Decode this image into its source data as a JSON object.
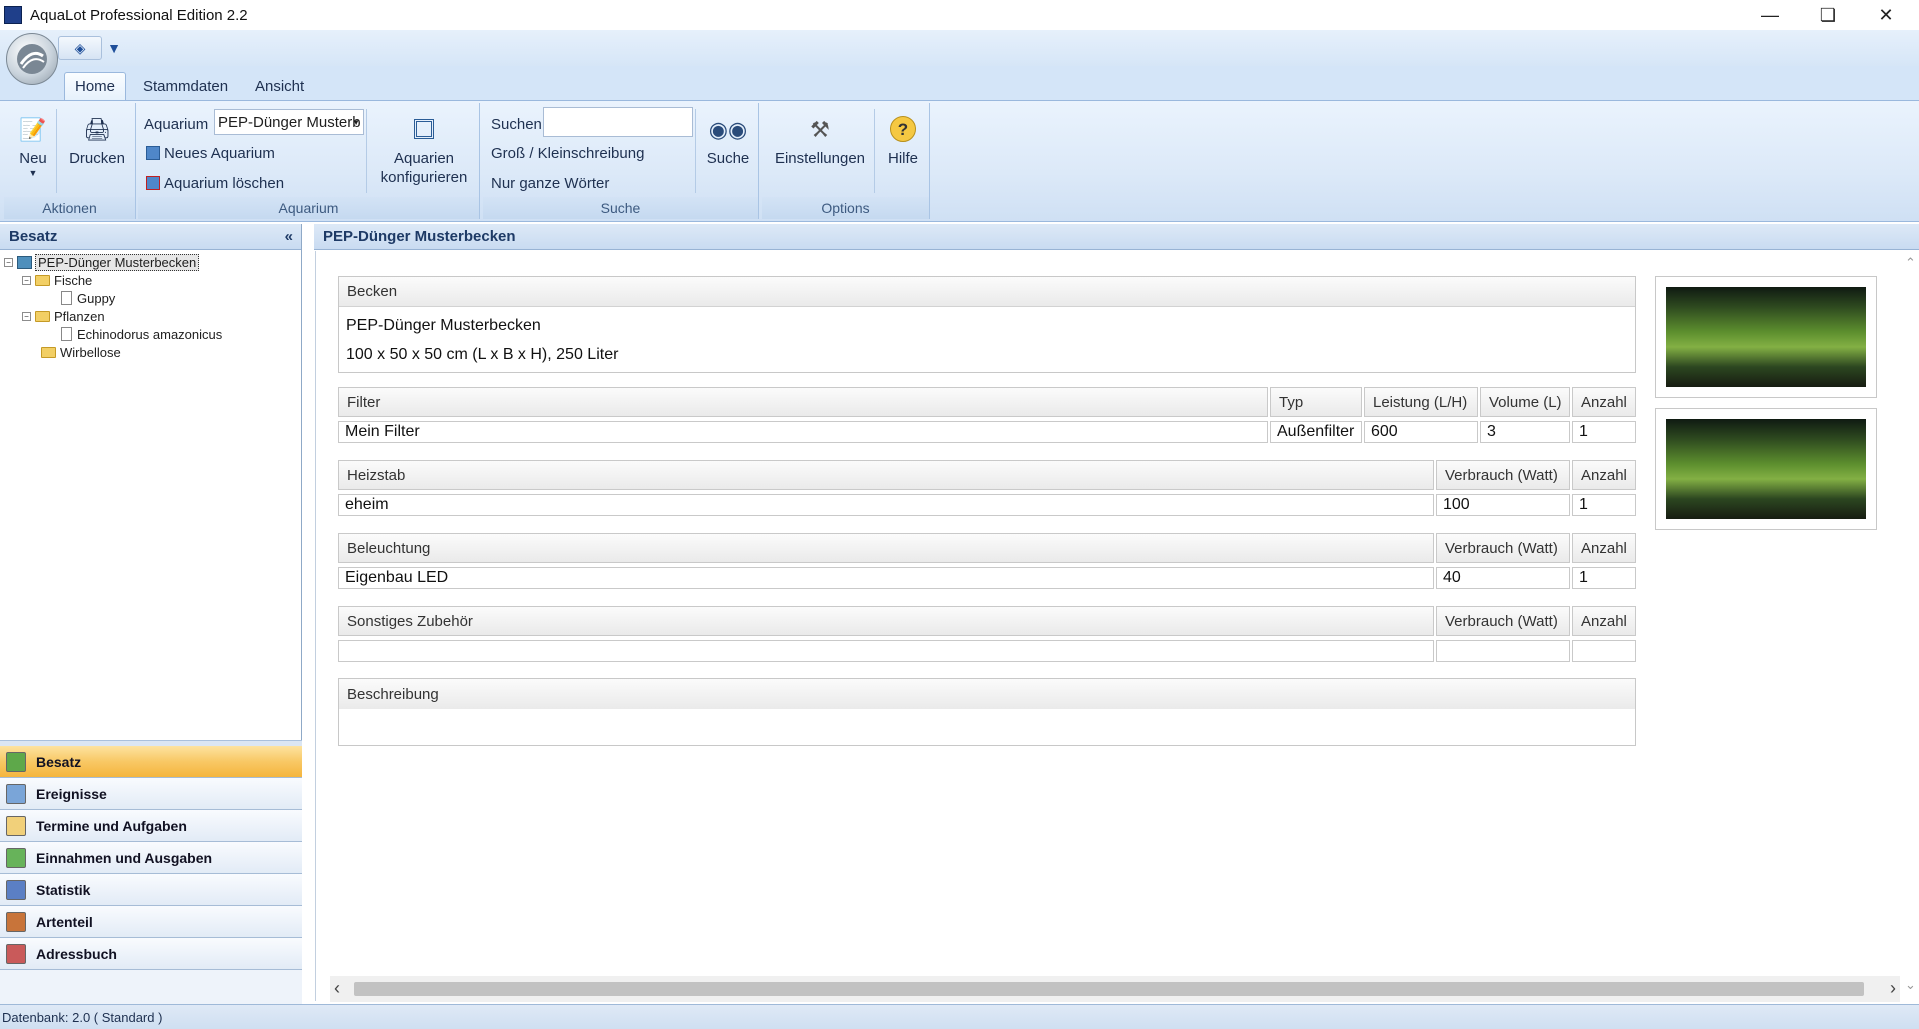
{
  "window": {
    "title": "AquaLot Professional Edition 2.2",
    "minimize_icon": "minimize-icon",
    "maximize_icon": "restore-icon",
    "close_icon": "close-icon"
  },
  "qat": {
    "icon1": "back-icon",
    "icon2": "dropdown-icon"
  },
  "tabs": [
    {
      "label": "Home"
    },
    {
      "label": "Stammdaten"
    },
    {
      "label": "Ansicht"
    }
  ],
  "ribbon": {
    "aktionen": {
      "label": "Aktionen",
      "neu": "Neu",
      "drucken": "Drucken"
    },
    "aquarium": {
      "label": "Aquarium",
      "combo_label": "Aquarium",
      "combo_value": "PEP-Dünger Musterb",
      "neues": "Neues Aquarium",
      "loeschen": "Aquarium löschen",
      "konfig_line1": "Aquarien",
      "konfig_line2": "konfigurieren"
    },
    "suche": {
      "label": "Suche",
      "suchen": "Suchen",
      "gross": "Groß / Kleinschreibung",
      "ganze": "Nur ganze Wörter",
      "button": "Suche"
    },
    "options": {
      "label": "Options",
      "einstellungen": "Einstellungen",
      "hilfe": "Hilfe"
    }
  },
  "leftpanel": {
    "header": "Besatz",
    "collapse": "«",
    "tree": {
      "root": "PEP-Dünger Musterbecken",
      "fische": "Fische",
      "guppy": "Guppy",
      "pflanzen": "Pflanzen",
      "echino": "Echinodorus amazonicus",
      "wirbellose": "Wirbellose"
    }
  },
  "nav": [
    {
      "label": "Besatz",
      "active": true
    },
    {
      "label": "Ereignisse"
    },
    {
      "label": "Termine und Aufgaben"
    },
    {
      "label": "Einnahmen und Ausgaben"
    },
    {
      "label": "Statistik"
    },
    {
      "label": "Artenteil"
    },
    {
      "label": "Adressbuch"
    }
  ],
  "main": {
    "header": "PEP-Dünger Musterbecken",
    "becken": {
      "label": "Becken",
      "name": "PEP-Dünger Musterbecken",
      "dims": "100 x 50 x 50 cm (L x B x H), 250 Liter"
    },
    "filter": {
      "h1": "Filter",
      "h2": "Typ",
      "h3": "Leistung (L/H)",
      "h4": "Volume (L)",
      "h5": "Anzahl",
      "v1": "Mein Filter",
      "v2": "Außenfilter",
      "v3": "600",
      "v4": "3",
      "v5": "1"
    },
    "heizstab": {
      "h1": "Heizstab",
      "h2": "Verbrauch (Watt)",
      "h3": "Anzahl",
      "v1": "eheim",
      "v2": "100",
      "v3": "1"
    },
    "beleuchtung": {
      "h1": "Beleuchtung",
      "h2": "Verbrauch (Watt)",
      "h3": "Anzahl",
      "v1": "Eigenbau LED",
      "v2": "40",
      "v3": "1"
    },
    "sonstiges": {
      "h1": "Sonstiges Zubehör",
      "h2": "Verbrauch (Watt)",
      "h3": "Anzahl"
    },
    "beschreibung": {
      "label": "Beschreibung"
    }
  },
  "status": {
    "text": "Datenbank: 2.0 ( Standard )"
  }
}
